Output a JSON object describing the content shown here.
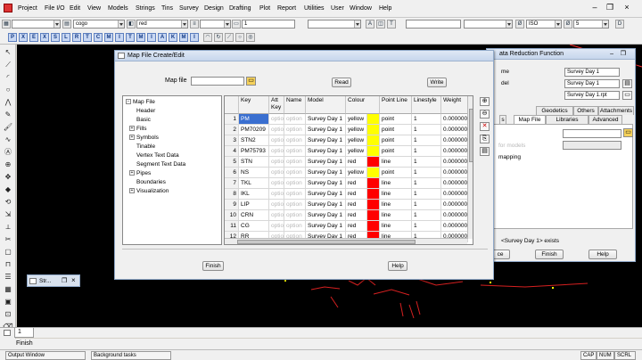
{
  "menu": [
    "Project",
    "File I/O",
    "Edit",
    "View",
    "Models",
    "Strings",
    "Tins",
    "Survey",
    "Design",
    "Drafting",
    "Plot",
    "Report",
    "Utilities",
    "User",
    "Window",
    "Help"
  ],
  "toolbar": {
    "model_value": "cogo",
    "colour_value": "red",
    "number_value": "1",
    "style_value": "ISO",
    "size_value": "5",
    "letters": [
      "P",
      "X",
      "E",
      "X",
      "S",
      "L",
      "R",
      "T",
      "C",
      "M",
      "I",
      "T",
      "M",
      "I",
      "A",
      "K",
      "M",
      "I"
    ]
  },
  "map_dialog": {
    "title": "Map File Create/Edit",
    "map_file_label": "Map file",
    "map_file_value": "",
    "read_button": "Read",
    "write_button": "Write",
    "tree_root": "Map File",
    "tree_items": [
      {
        "label": "Header",
        "expand": false
      },
      {
        "label": "Basic",
        "expand": false
      },
      {
        "label": "Fills",
        "expand": true
      },
      {
        "label": "Symbols",
        "expand": true
      },
      {
        "label": "Tinable",
        "expand": false
      },
      {
        "label": "Vertex Text Data",
        "expand": false
      },
      {
        "label": "Segment Text Data",
        "expand": false
      },
      {
        "label": "Pipes",
        "expand": true
      },
      {
        "label": "Boundaries",
        "expand": false
      },
      {
        "label": "Visualization",
        "expand": true
      }
    ],
    "columns": [
      "Key",
      "Att Key",
      "Name",
      "Model",
      "Colour",
      "Point Line",
      "Linestyle",
      "Weight"
    ],
    "rows": [
      {
        "n": "1",
        "key": "PM",
        "att": "optio",
        "name": "option",
        "model": "Survey Day 1",
        "colour": "yellow",
        "swatch": "#ffff00",
        "pl": "point",
        "ls": "1",
        "w": "0.000000"
      },
      {
        "n": "2",
        "key": "PM70209",
        "att": "optio",
        "name": "option",
        "model": "Survey Day 1",
        "colour": "yellow",
        "swatch": "#ffff00",
        "pl": "point",
        "ls": "1",
        "w": "0.000000"
      },
      {
        "n": "3",
        "key": "STN2",
        "att": "optio",
        "name": "option",
        "model": "Survey Day 1",
        "colour": "yellow",
        "swatch": "#ffff00",
        "pl": "point",
        "ls": "1",
        "w": "0.000000"
      },
      {
        "n": "4",
        "key": "PM75793",
        "att": "optio",
        "name": "option",
        "model": "Survey Day 1",
        "colour": "yellow",
        "swatch": "#ffff00",
        "pl": "point",
        "ls": "1",
        "w": "0.000000"
      },
      {
        "n": "5",
        "key": "STN",
        "att": "optio",
        "name": "option",
        "model": "Survey Day 1",
        "colour": "red",
        "swatch": "#ff0000",
        "pl": "line",
        "ls": "1",
        "w": "0.000000"
      },
      {
        "n": "6",
        "key": "NS",
        "att": "optio",
        "name": "option",
        "model": "Survey Day 1",
        "colour": "yellow",
        "swatch": "#ffff00",
        "pl": "point",
        "ls": "1",
        "w": "0.000000"
      },
      {
        "n": "7",
        "key": "TKL",
        "att": "optio",
        "name": "option",
        "model": "Survey Day 1",
        "colour": "red",
        "swatch": "#ff0000",
        "pl": "line",
        "ls": "1",
        "w": "0.000000"
      },
      {
        "n": "8",
        "key": "IKL",
        "att": "optio",
        "name": "option",
        "model": "Survey Day 1",
        "colour": "red",
        "swatch": "#ff0000",
        "pl": "line",
        "ls": "1",
        "w": "0.000000"
      },
      {
        "n": "9",
        "key": "LIP",
        "att": "optio",
        "name": "option",
        "model": "Survey Day 1",
        "colour": "red",
        "swatch": "#ff0000",
        "pl": "line",
        "ls": "1",
        "w": "0.000000"
      },
      {
        "n": "10",
        "key": "CRN",
        "att": "optio",
        "name": "option",
        "model": "Survey Day 1",
        "colour": "red",
        "swatch": "#ff0000",
        "pl": "line",
        "ls": "1",
        "w": "0.000000"
      },
      {
        "n": "11",
        "key": "CG",
        "att": "optio",
        "name": "option",
        "model": "Survey Day 1",
        "colour": "red",
        "swatch": "#ff0000",
        "pl": "line",
        "ls": "1",
        "w": "0.000000"
      },
      {
        "n": "12",
        "key": "RR",
        "att": "optio",
        "name": "option",
        "model": "Survey Day 1",
        "colour": "red",
        "swatch": "#ff0000",
        "pl": "line",
        "ls": "1",
        "w": "0.000000"
      }
    ],
    "finish_button": "Finish",
    "help_button": "Help"
  },
  "data_reduction": {
    "title": "ata Reduction Function",
    "label_name": "me",
    "label_model": "del",
    "name_value": "Survey Day 1",
    "model_value": "Survey Day 1",
    "report_value": "Survey Day 1.rpt",
    "tabs_row1": [
      "Geodetics",
      "Others",
      "Attachments"
    ],
    "tabs_row2": [
      "Map File",
      "Libraries",
      "Advanced"
    ],
    "tab_partial": "s",
    "faded_text": "for models",
    "mapping_text": "mapping",
    "message": "Survey Day 1> exists",
    "msg_prefix": "<",
    "process_partial": "ce",
    "finish_button": "Finish",
    "help_button": "Help"
  },
  "mini_window_title": "Str...",
  "status": {
    "tab_number": "1",
    "status_text": "Finish",
    "cap": "CAP",
    "num": "NUM",
    "scrl": "SCRL",
    "output_window": "Output Window",
    "background_tasks": "Background tasks"
  },
  "colors": {
    "accent": "#3a6fd0",
    "yellow": "#ffff00",
    "red": "#ff0000"
  }
}
